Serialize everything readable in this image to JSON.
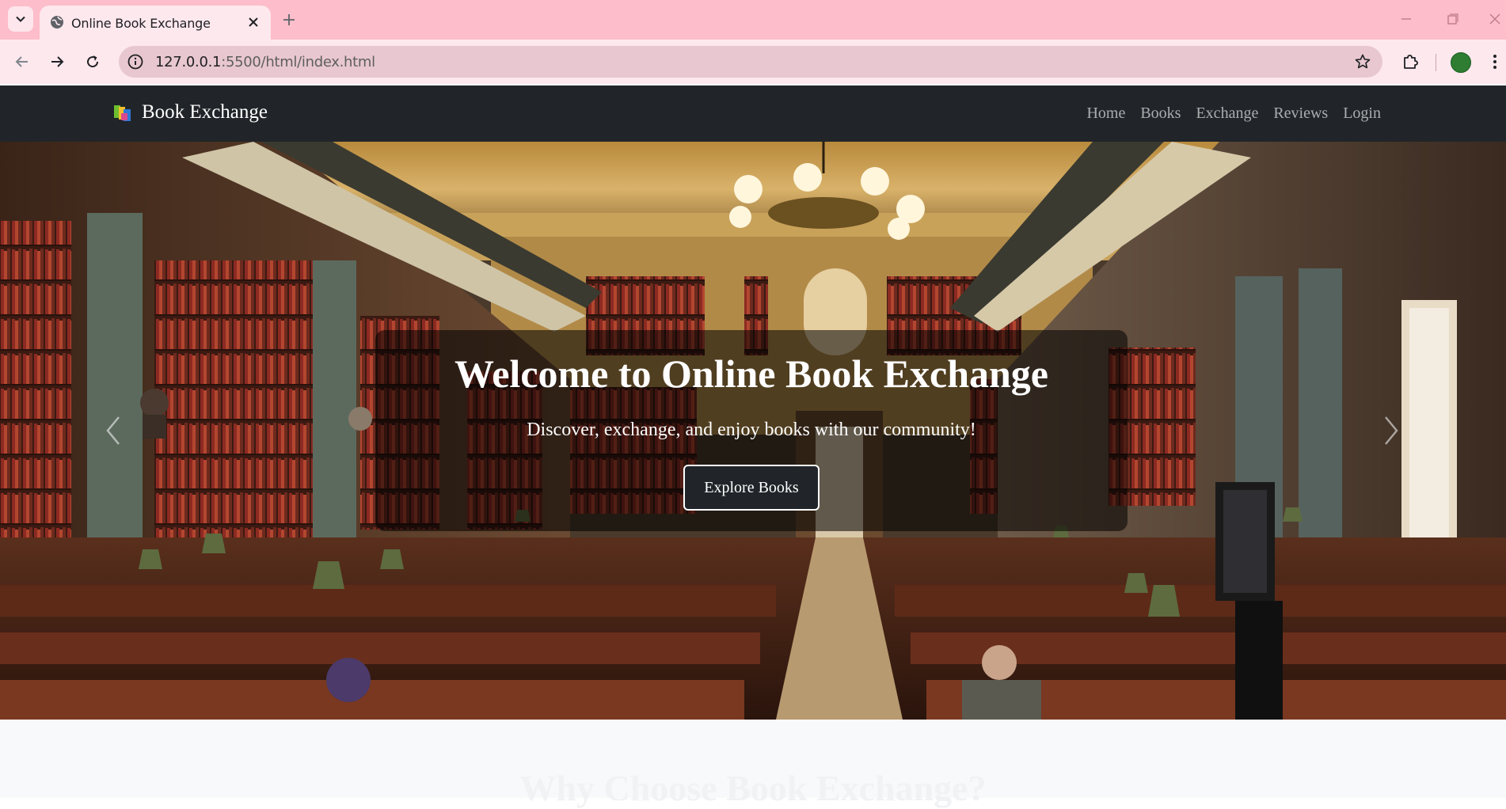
{
  "browser": {
    "tab_title": "Online Book Exchange",
    "url_host": "127.0.0.1",
    "url_path": ":5500/html/index.html"
  },
  "navbar": {
    "brand": "Book Exchange",
    "links": [
      "Home",
      "Books",
      "Exchange",
      "Reviews",
      "Login"
    ]
  },
  "hero": {
    "title": "Welcome to Online Book Exchange",
    "subtitle": "Discover, exchange, and enjoy books with our community!",
    "button": "Explore Books"
  },
  "features": {
    "title": "Why Choose Book Exchange?"
  }
}
